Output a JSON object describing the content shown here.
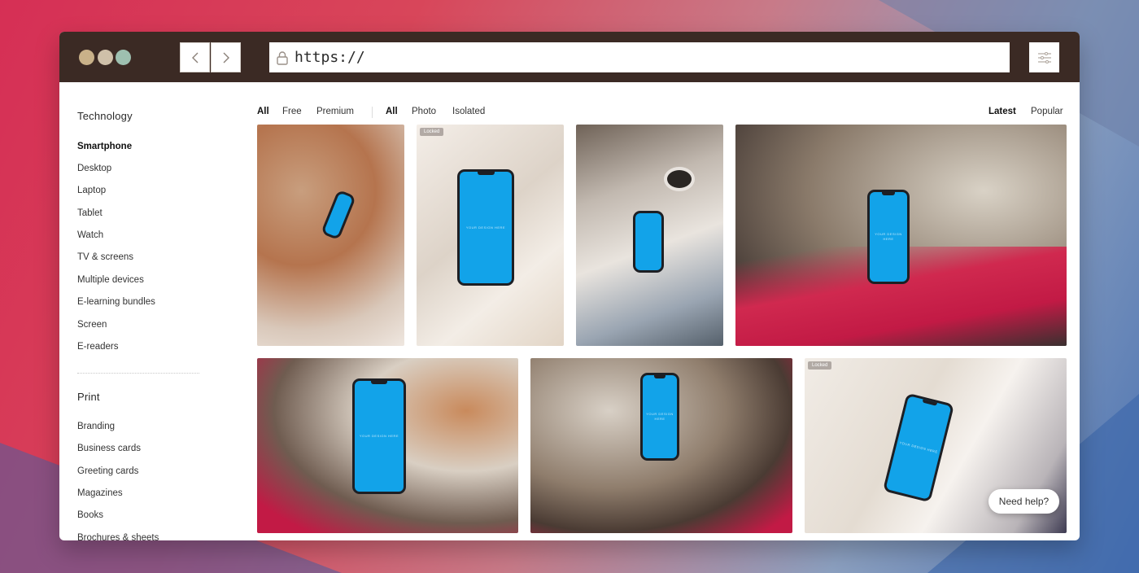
{
  "window": {
    "dots": [
      "#c9b189",
      "#cfc0a9",
      "#9ec0b0"
    ],
    "url": "https://",
    "icons": {
      "back": "chevron-left-icon",
      "forward": "chevron-right-icon",
      "lock": "lock-icon",
      "settings": "sliders-icon"
    }
  },
  "sidebar": {
    "technology": {
      "title": "Technology",
      "items": [
        "Smartphone",
        "Desktop",
        "Laptop",
        "Tablet",
        "Watch",
        "TV & screens",
        "Multiple devices",
        "E-learning bundles",
        "Screen",
        "E-readers"
      ],
      "active": "Smartphone"
    },
    "print": {
      "title": "Print",
      "items": [
        "Branding",
        "Business cards",
        "Greeting cards",
        "Magazines",
        "Books",
        "Brochures & sheets"
      ]
    }
  },
  "filters": {
    "pricing": [
      "All",
      "Free",
      "Premium"
    ],
    "pricing_active": "All",
    "type": [
      "All",
      "Photo",
      "Isolated"
    ],
    "type_active": "All",
    "sort": [
      "Latest",
      "Popular"
    ],
    "sort_active": "Latest"
  },
  "tiles": {
    "locked_label": "Locked",
    "screen_text": "YOUR DESIGN HERE",
    "screen_color": "#12a3e9"
  },
  "help": {
    "label": "Need help?"
  }
}
